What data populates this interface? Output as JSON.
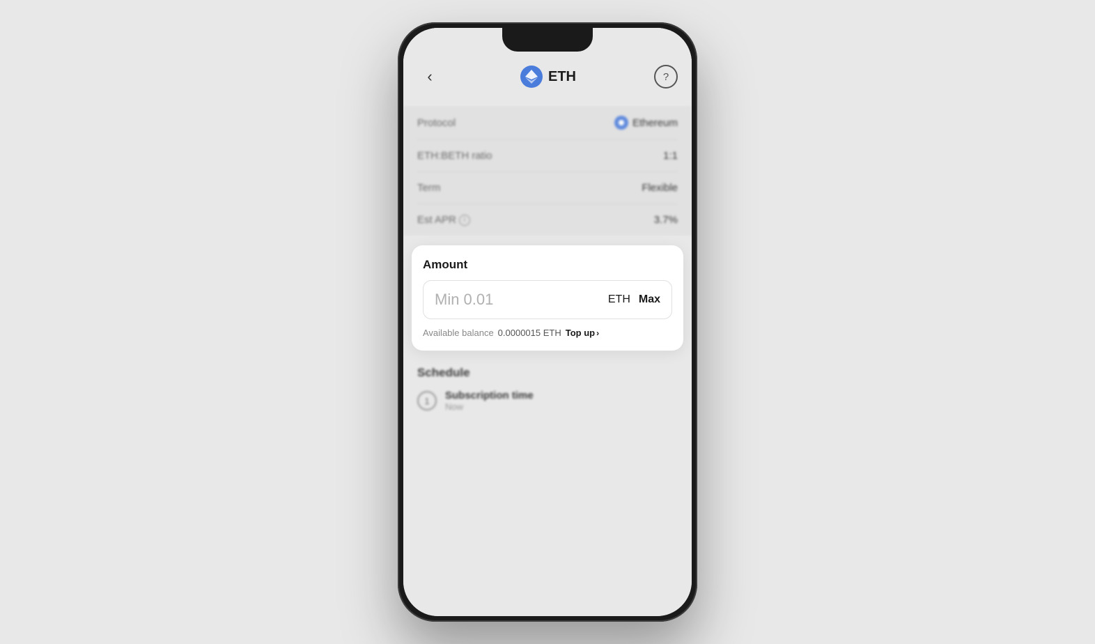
{
  "header": {
    "back_label": "<",
    "title": "ETH",
    "help_label": "?"
  },
  "info_rows": [
    {
      "label": "Protocol",
      "value": "Ethereum",
      "has_icon": true
    },
    {
      "label": "ETH:BETH ratio",
      "value": "1:1",
      "has_icon": false
    },
    {
      "label": "Term",
      "value": "Flexible",
      "has_icon": false
    },
    {
      "label": "Est APR",
      "value": "3.7%",
      "has_info": true,
      "has_icon": false
    }
  ],
  "amount_card": {
    "label": "Amount",
    "input_placeholder": "Min 0.01",
    "currency": "ETH",
    "max_button": "Max",
    "balance_label": "Available balance",
    "balance_value": "0.0000015 ETH",
    "topup_label": "Top up",
    "topup_arrow": "›"
  },
  "schedule": {
    "title": "Schedule",
    "items": [
      {
        "step": "1",
        "title": "Subscription time",
        "subtitle": "Now"
      }
    ]
  }
}
